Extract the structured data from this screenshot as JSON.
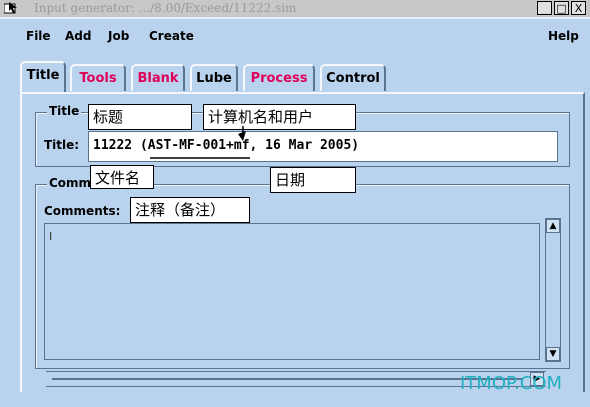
{
  "window": {
    "title": "Input generator: .../8.00/Exceed/11222.sim",
    "minimize": "_",
    "maximize": "□",
    "close": "X"
  },
  "menu": {
    "file": "File",
    "add": "Add",
    "job": "Job",
    "create": "Create",
    "help": "Help"
  },
  "tabs": [
    "Title",
    "Tools",
    "Blank",
    "Lube",
    "Process",
    "Control"
  ],
  "title_group": {
    "legend": "Title",
    "field_label": "Title:",
    "value": "11222 (AST-MF-001+mf, 16 Mar 2005)"
  },
  "comments_group": {
    "legend": "Comments",
    "field_label": "Comments:",
    "value": "",
    "cursor": "I"
  },
  "annotations": {
    "title": "标题",
    "computer_user": "计算机名和用户",
    "filename": "文件名",
    "date": "日期",
    "comments": "注释（备注）"
  },
  "watermark": "ITMOP.COM",
  "colors": {
    "background": "#b9d3ee",
    "accent_tab": "#e0005a",
    "watermark": "#20b0c0"
  }
}
